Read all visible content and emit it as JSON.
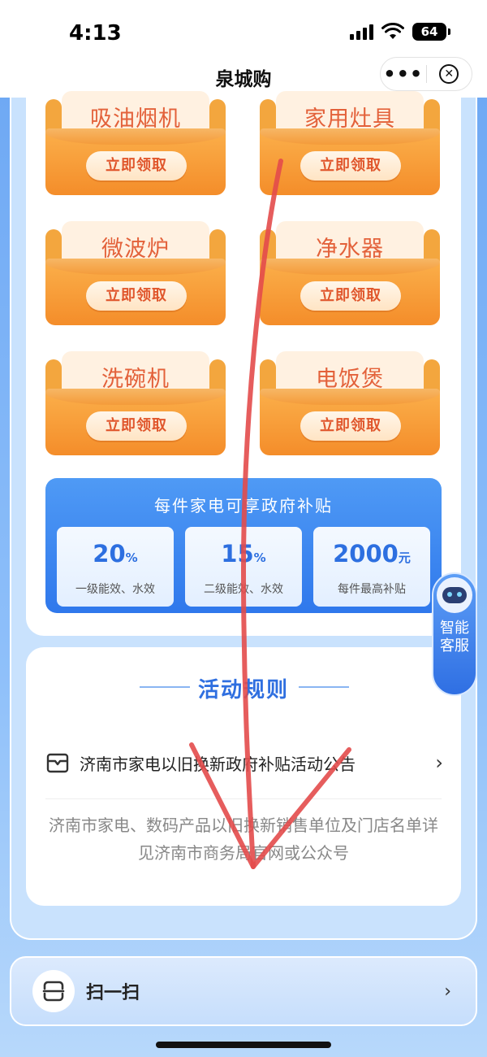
{
  "status_bar": {
    "time": "4:13",
    "battery": "64"
  },
  "nav": {
    "title": "泉城购",
    "more_icon": "more-dots-icon",
    "close_icon": "close-circle-icon"
  },
  "cards": [
    {
      "name": "吸油烟机",
      "button": "立即领取"
    },
    {
      "name": "家用灶具",
      "button": "立即领取"
    },
    {
      "name": "微波炉",
      "button": "立即领取"
    },
    {
      "name": "净水器",
      "button": "立即领取"
    },
    {
      "name": "洗碗机",
      "button": "立即领取"
    },
    {
      "name": "电饭煲",
      "button": "立即领取"
    }
  ],
  "subsidy": {
    "title": "每件家电可享政府补贴",
    "stats": [
      {
        "value": "20",
        "unit": "%",
        "label": "一级能效、水效"
      },
      {
        "value": "15",
        "unit": "%",
        "label": "二级能效、水效"
      },
      {
        "value": "2000",
        "unit": "元",
        "label": "每件最高补贴"
      }
    ]
  },
  "assistant": {
    "label": "智能客服"
  },
  "rules": {
    "title": "活动规则",
    "notice": "济南市家电以旧换新政府补贴活动公告",
    "description": "济南市家电、数码产品以旧换新销售单位及门店名单详见济南市商务局官网或公众号"
  },
  "scan": {
    "label": "扫一扫"
  },
  "colors": {
    "accent_blue": "#2f6fe0",
    "card_orange": "#f48d2a",
    "card_text": "#e3613a",
    "annotation_red": "#e34b4b"
  }
}
